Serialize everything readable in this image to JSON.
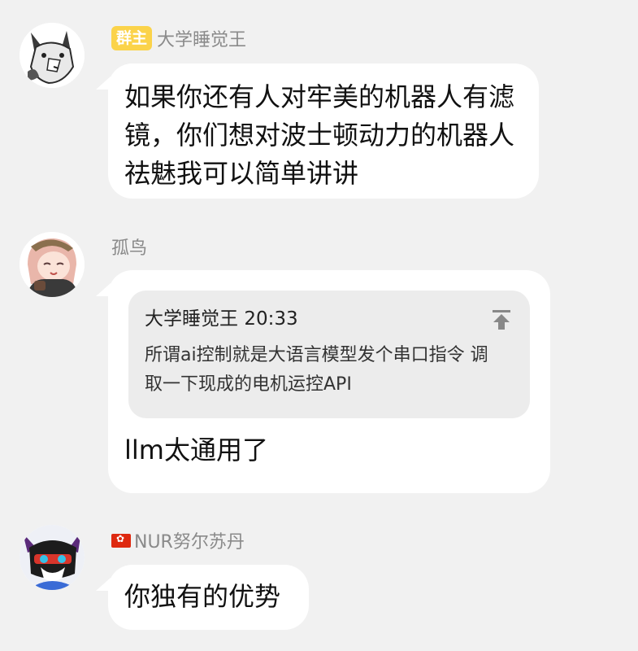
{
  "messages": [
    {
      "badge": "群主",
      "sender": "大学睡觉王",
      "text": "如果你还有人对牢美的机器人有滤镜，你们想对波士顿动力的机器人祛魅我可以简单讲讲"
    },
    {
      "sender": "孤鸟",
      "quote": {
        "author": "大学睡觉王",
        "time": "20:33",
        "text": "所谓ai控制就是大语言模型发个串口指令 调取一下现成的电机运控API"
      },
      "text": "llm太通用了"
    },
    {
      "sender": "NUR努尔苏丹",
      "text": "你独有的优势"
    }
  ],
  "icons": {
    "flag": "hong-kong-flag-icon",
    "pin": "pin-to-top-icon"
  }
}
